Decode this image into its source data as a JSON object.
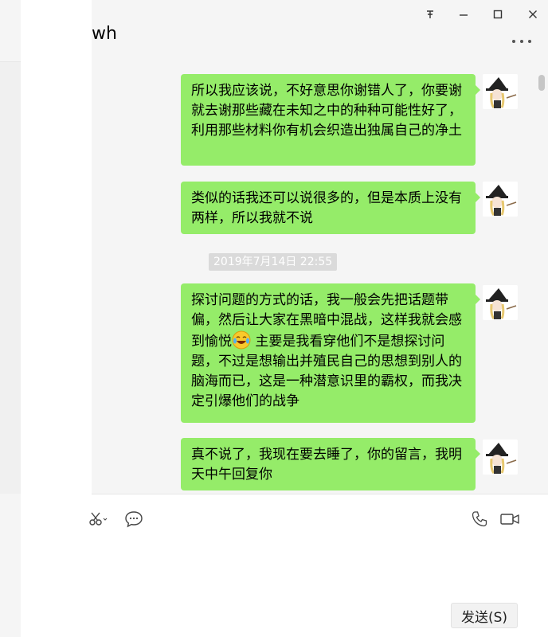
{
  "window": {
    "title": "wh",
    "pin_icon": "pin-icon",
    "minimize_icon": "minimize-icon",
    "maximize_icon": "maximize-icon",
    "close_icon": "close-icon",
    "more_icon": "more-icon"
  },
  "messages": [
    {
      "side": "self",
      "text": "所以我应该说，不好意思你谢错人了，你要谢就去谢那些藏在未知之中的种种可能性好了，利用那些材料你有机会织造出独属自己的净土"
    },
    {
      "side": "self",
      "text": "类似的话我还可以说很多的，但是本质上没有两样，所以我就不说"
    },
    {
      "timestamp": "2019年7月14日 22:55"
    },
    {
      "side": "self",
      "text_before_emoji": "探讨问题的方式的话，我一般会先把话题带偏，然后让大家在黑暗中混战，这样我就会感到愉悦",
      "emoji": "tears-of-joy-emoji",
      "text_after_emoji": " 主要是我看穿他们不是想探讨问题，不过是想输出并殖民自己的思想到别人的脑海而已，这是一种潜意识里的霸权，而我决定引爆他们的战争"
    },
    {
      "side": "self",
      "text": "真不说了，我现在要去睡了，你的留言，我明天中午回复你"
    }
  ],
  "toolbar": {
    "left_icons": [
      "scissors-icon",
      "chat-bubble-icon"
    ],
    "right_icons": [
      "phone-icon",
      "video-icon"
    ]
  },
  "input": {
    "value": ""
  },
  "send_label": "发送(S)",
  "colors": {
    "bubble": "#95ec69",
    "background": "#f5f5f5"
  }
}
